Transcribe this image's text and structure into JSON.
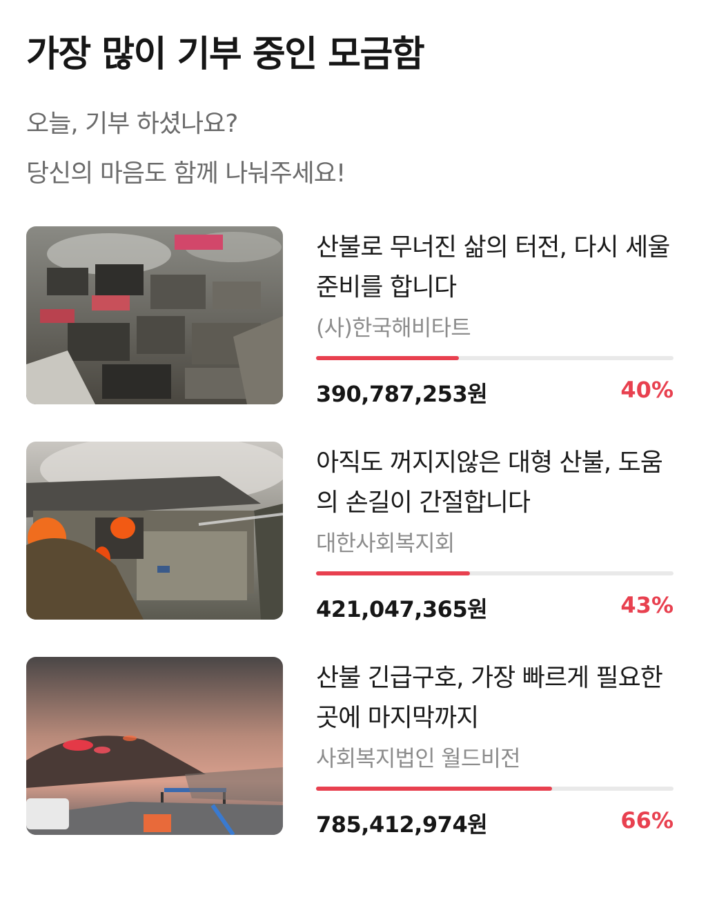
{
  "header": {
    "title": "가장 많이 기부 중인 모금함",
    "subtitle_line1": "오늘, 기부 하셨나요?",
    "subtitle_line2": "당신의 마음도 함께 나눠주세요!"
  },
  "campaigns": [
    {
      "title": "산불로 무너진 삶의 터전, 다시 세울 준비를 합니다",
      "organization": "(사)한국해비타트",
      "amount": "390,787,253원",
      "percent_label": "40%",
      "progress": 0.4,
      "image": "burned-village-photo"
    },
    {
      "title": "아직도 꺼지지않은 대형 산불, 도움의 손길이 간절합니다",
      "organization": "대한사회복지회",
      "amount": "421,047,365원",
      "percent_label": "43%",
      "progress": 0.43,
      "image": "burning-house-photo"
    },
    {
      "title": "산불 긴급구호, 가장 빠르게 필요한 곳에 마지막까지",
      "organization": "사회복지법인 월드비전",
      "amount": "785,412,974원",
      "percent_label": "66%",
      "progress": 0.66,
      "image": "wildfire-highway-photo"
    }
  ],
  "colors": {
    "accent": "#e8404f",
    "track": "#e9e9e9",
    "muted_text": "#8c8c8c"
  }
}
